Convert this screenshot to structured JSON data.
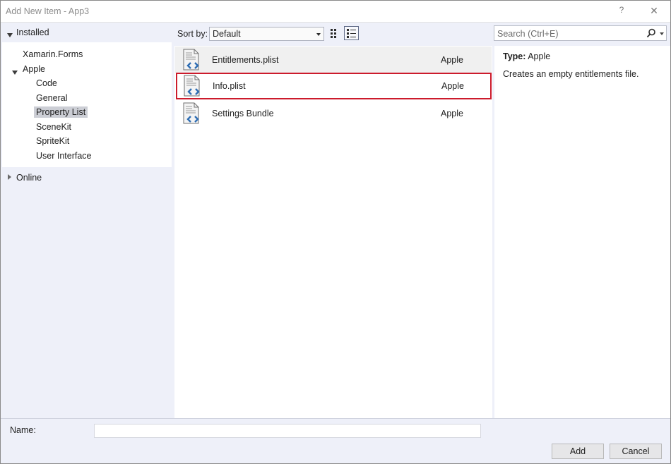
{
  "window": {
    "title": "Add New Item - App3",
    "help_glyph": "?",
    "close_glyph": "✕"
  },
  "tree": {
    "installed_label": "Installed",
    "items": [
      {
        "label": "Xamarin.Forms"
      },
      {
        "label": "Apple"
      },
      {
        "label": "Code"
      },
      {
        "label": "General"
      },
      {
        "label": "Property List",
        "selected": true
      },
      {
        "label": "SceneKit"
      },
      {
        "label": "SpriteKit"
      },
      {
        "label": "User Interface"
      }
    ],
    "online_label": "Online"
  },
  "toolbar": {
    "sort_label": "Sort by:",
    "sort_value": "Default"
  },
  "search": {
    "placeholder": "Search (Ctrl+E)"
  },
  "templates": [
    {
      "name": "Entitlements.plist",
      "category": "Apple"
    },
    {
      "name": "Info.plist",
      "category": "Apple",
      "selected": true
    },
    {
      "name": "Settings Bundle",
      "category": "Apple"
    }
  ],
  "details": {
    "type_label": "Type:",
    "type_value": "Apple",
    "description": "Creates an empty entitlements file."
  },
  "footer": {
    "name_label": "Name:",
    "name_value": "",
    "add_label": "Add",
    "cancel_label": "Cancel"
  },
  "colors": {
    "selection_outline": "#cc1b2c",
    "accent_icon": "#2e6db3"
  }
}
